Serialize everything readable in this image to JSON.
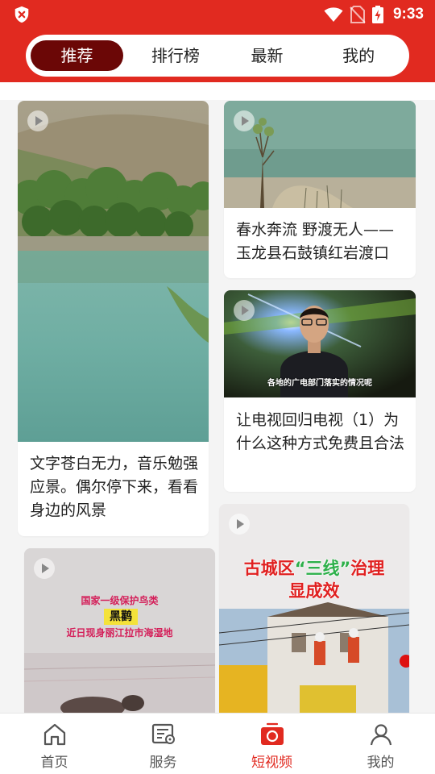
{
  "status_bar": {
    "time": "9:33"
  },
  "tabs": [
    {
      "label": "推荐",
      "active": true
    },
    {
      "label": "排行榜",
      "active": false
    },
    {
      "label": "最新",
      "active": false
    },
    {
      "label": "我的",
      "active": false
    }
  ],
  "cards": {
    "c1": {
      "title": "文字苍白无力，音乐勉强应景。偶尔停下来，看看身边的风景"
    },
    "c2": {
      "title": "春水奔流 野渡无人——玉龙县石鼓镇红岩渡口"
    },
    "c3": {
      "title": "让电视回归电视（1）为什么这种方式免费且合法",
      "subtitle_overlay": "各地的广电部门落实的情况呢"
    },
    "c4": {
      "overlay_line1": "国家一级保护鸟类",
      "overlay_line2": "黑鹳",
      "overlay_line3": "近日现身丽江拉市海湿地"
    },
    "c5": {
      "overlay_line1_pre": "古城区",
      "overlay_line1_q": "“三线”",
      "overlay_line1_post": "治理",
      "overlay_line2": "显成效"
    }
  },
  "nav": [
    {
      "label": "首页",
      "icon": "home-icon",
      "active": false
    },
    {
      "label": "服务",
      "icon": "service-icon",
      "active": false
    },
    {
      "label": "短视频",
      "icon": "short-video-icon",
      "active": true
    },
    {
      "label": "我的",
      "icon": "profile-icon",
      "active": false
    }
  ],
  "colors": {
    "brand_red": "#e12a20",
    "active_tab": "#6b0706",
    "text": "#222222"
  }
}
